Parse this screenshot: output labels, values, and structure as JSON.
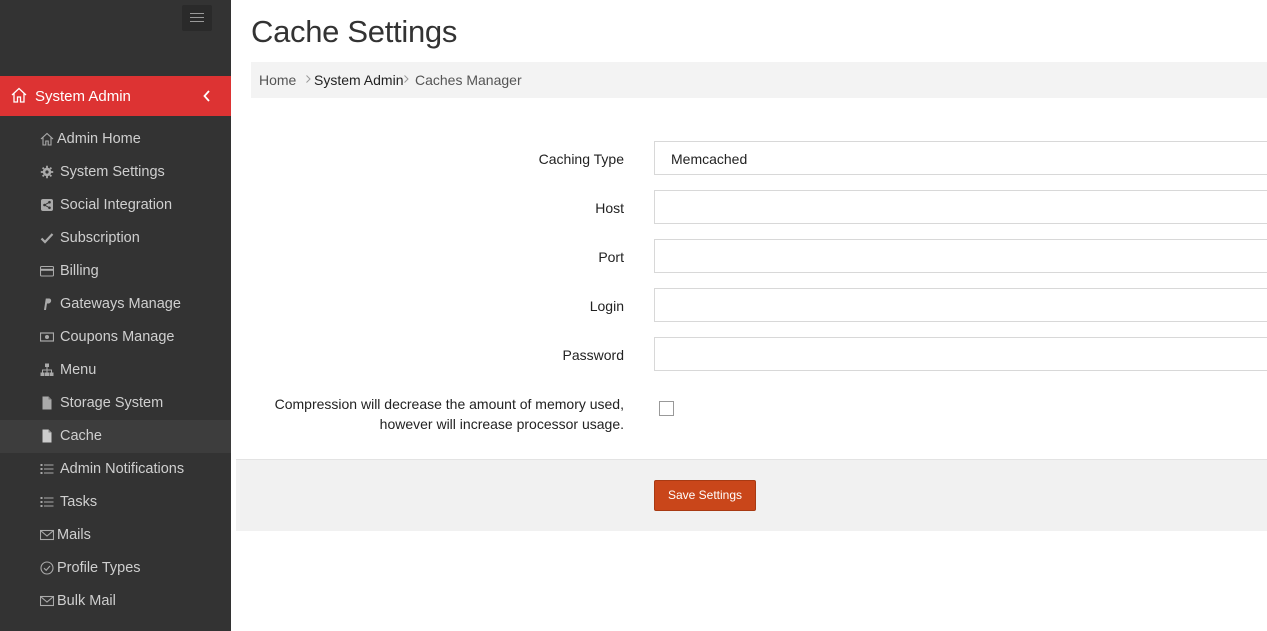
{
  "sidebar": {
    "section_label": "System Admin",
    "items": [
      {
        "label": "Admin Home",
        "icon": "home-icon"
      },
      {
        "label": "System Settings",
        "icon": "gear-icon"
      },
      {
        "label": "Social Integration",
        "icon": "share-icon"
      },
      {
        "label": "Subscription",
        "icon": "check-icon"
      },
      {
        "label": "Billing",
        "icon": "credit-card-icon"
      },
      {
        "label": "Gateways Manage",
        "icon": "paypal-icon"
      },
      {
        "label": "Coupons Manage",
        "icon": "money-icon"
      },
      {
        "label": "Menu",
        "icon": "sitemap-icon"
      },
      {
        "label": "Storage System",
        "icon": "file-icon"
      },
      {
        "label": "Cache",
        "icon": "file-icon",
        "active": true
      },
      {
        "label": "Admin Notifications",
        "icon": "list-icon"
      },
      {
        "label": "Tasks",
        "icon": "list-icon"
      },
      {
        "label": "Mails",
        "icon": "envelope-icon"
      },
      {
        "label": "Profile Types",
        "icon": "check-circle-icon"
      },
      {
        "label": "Bulk Mail",
        "icon": "envelope-icon"
      }
    ]
  },
  "page": {
    "title": "Cache Settings",
    "breadcrumb": [
      "Home",
      "System Admin",
      "Caches Manager"
    ]
  },
  "form": {
    "caching_type_label": "Caching Type",
    "caching_type_value": "Memcached",
    "host_label": "Host",
    "host_value": "",
    "port_label": "Port",
    "port_value": "",
    "login_label": "Login",
    "login_value": "",
    "password_label": "Password",
    "password_value": "",
    "compression_line1": "Compression will decrease the amount of memory used,",
    "compression_line2": "however will increase processor usage.",
    "compression_checked": false,
    "save_label": "Save Settings"
  },
  "colors": {
    "sidebar_bg": "#333333",
    "accent_red": "#dd3333",
    "save_button": "#c9461a"
  }
}
